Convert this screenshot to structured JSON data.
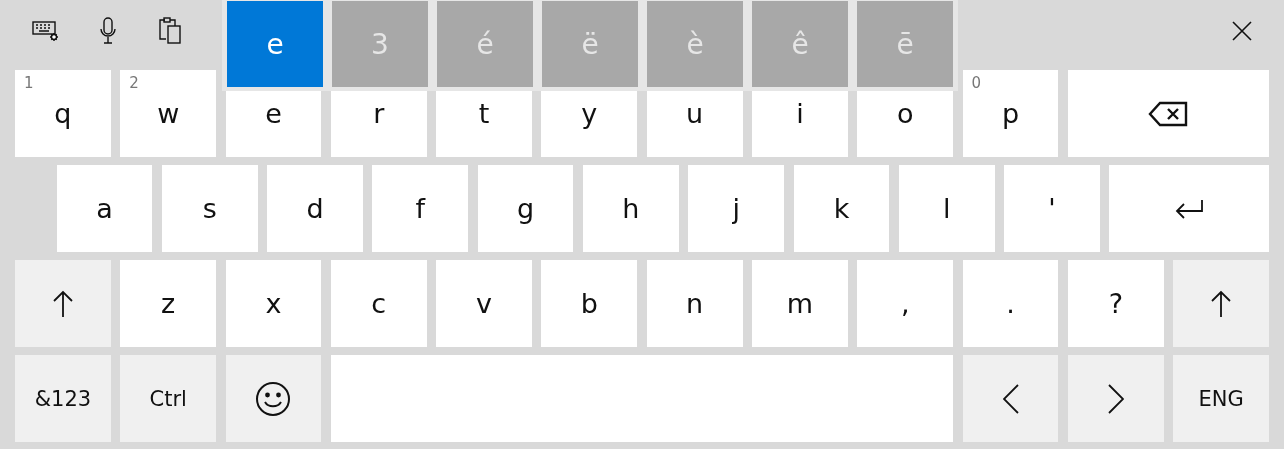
{
  "toolbar": [
    {
      "kind": "keyboard-settings"
    },
    {
      "kind": "microphone"
    },
    {
      "kind": "clipboard"
    }
  ],
  "close": {
    "kind": "close"
  },
  "candidates": [
    {
      "label": "e",
      "selected": true
    },
    {
      "label": "3",
      "selected": false
    },
    {
      "label": "é",
      "selected": false
    },
    {
      "label": "ë",
      "selected": false
    },
    {
      "label": "è",
      "selected": false
    },
    {
      "label": "ê",
      "selected": false
    },
    {
      "label": "ē",
      "selected": false
    }
  ],
  "rows": [
    {
      "keys": [
        {
          "kind": "char",
          "label": "q",
          "hint": "1"
        },
        {
          "kind": "char",
          "label": "w",
          "hint": "2"
        },
        {
          "kind": "char",
          "label": "e"
        },
        {
          "kind": "char",
          "label": "r"
        },
        {
          "kind": "char",
          "label": "t"
        },
        {
          "kind": "char",
          "label": "y"
        },
        {
          "kind": "char",
          "label": "u"
        },
        {
          "kind": "char",
          "label": "i"
        },
        {
          "kind": "char",
          "label": "o"
        },
        {
          "kind": "char",
          "label": "p",
          "hint": "0"
        },
        {
          "kind": "backspace"
        }
      ]
    },
    {
      "keys": [
        {
          "kind": "char",
          "label": "a"
        },
        {
          "kind": "char",
          "label": "s"
        },
        {
          "kind": "char",
          "label": "d"
        },
        {
          "kind": "char",
          "label": "f"
        },
        {
          "kind": "char",
          "label": "g"
        },
        {
          "kind": "char",
          "label": "h"
        },
        {
          "kind": "char",
          "label": "j"
        },
        {
          "kind": "char",
          "label": "k"
        },
        {
          "kind": "char",
          "label": "l"
        },
        {
          "kind": "char",
          "label": "'"
        },
        {
          "kind": "enter"
        }
      ]
    },
    {
      "keys": [
        {
          "kind": "shift"
        },
        {
          "kind": "char",
          "label": "z"
        },
        {
          "kind": "char",
          "label": "x"
        },
        {
          "kind": "char",
          "label": "c"
        },
        {
          "kind": "char",
          "label": "v"
        },
        {
          "kind": "char",
          "label": "b"
        },
        {
          "kind": "char",
          "label": "n"
        },
        {
          "kind": "char",
          "label": "m"
        },
        {
          "kind": "char",
          "label": ","
        },
        {
          "kind": "char",
          "label": "."
        },
        {
          "kind": "char",
          "label": "?"
        },
        {
          "kind": "shift"
        }
      ]
    },
    {
      "keys": [
        {
          "kind": "function",
          "label": "&123"
        },
        {
          "kind": "function",
          "label": "Ctrl"
        },
        {
          "kind": "emoji"
        },
        {
          "kind": "space"
        },
        {
          "kind": "left"
        },
        {
          "kind": "right"
        },
        {
          "kind": "function",
          "label": "ENG"
        }
      ]
    }
  ]
}
